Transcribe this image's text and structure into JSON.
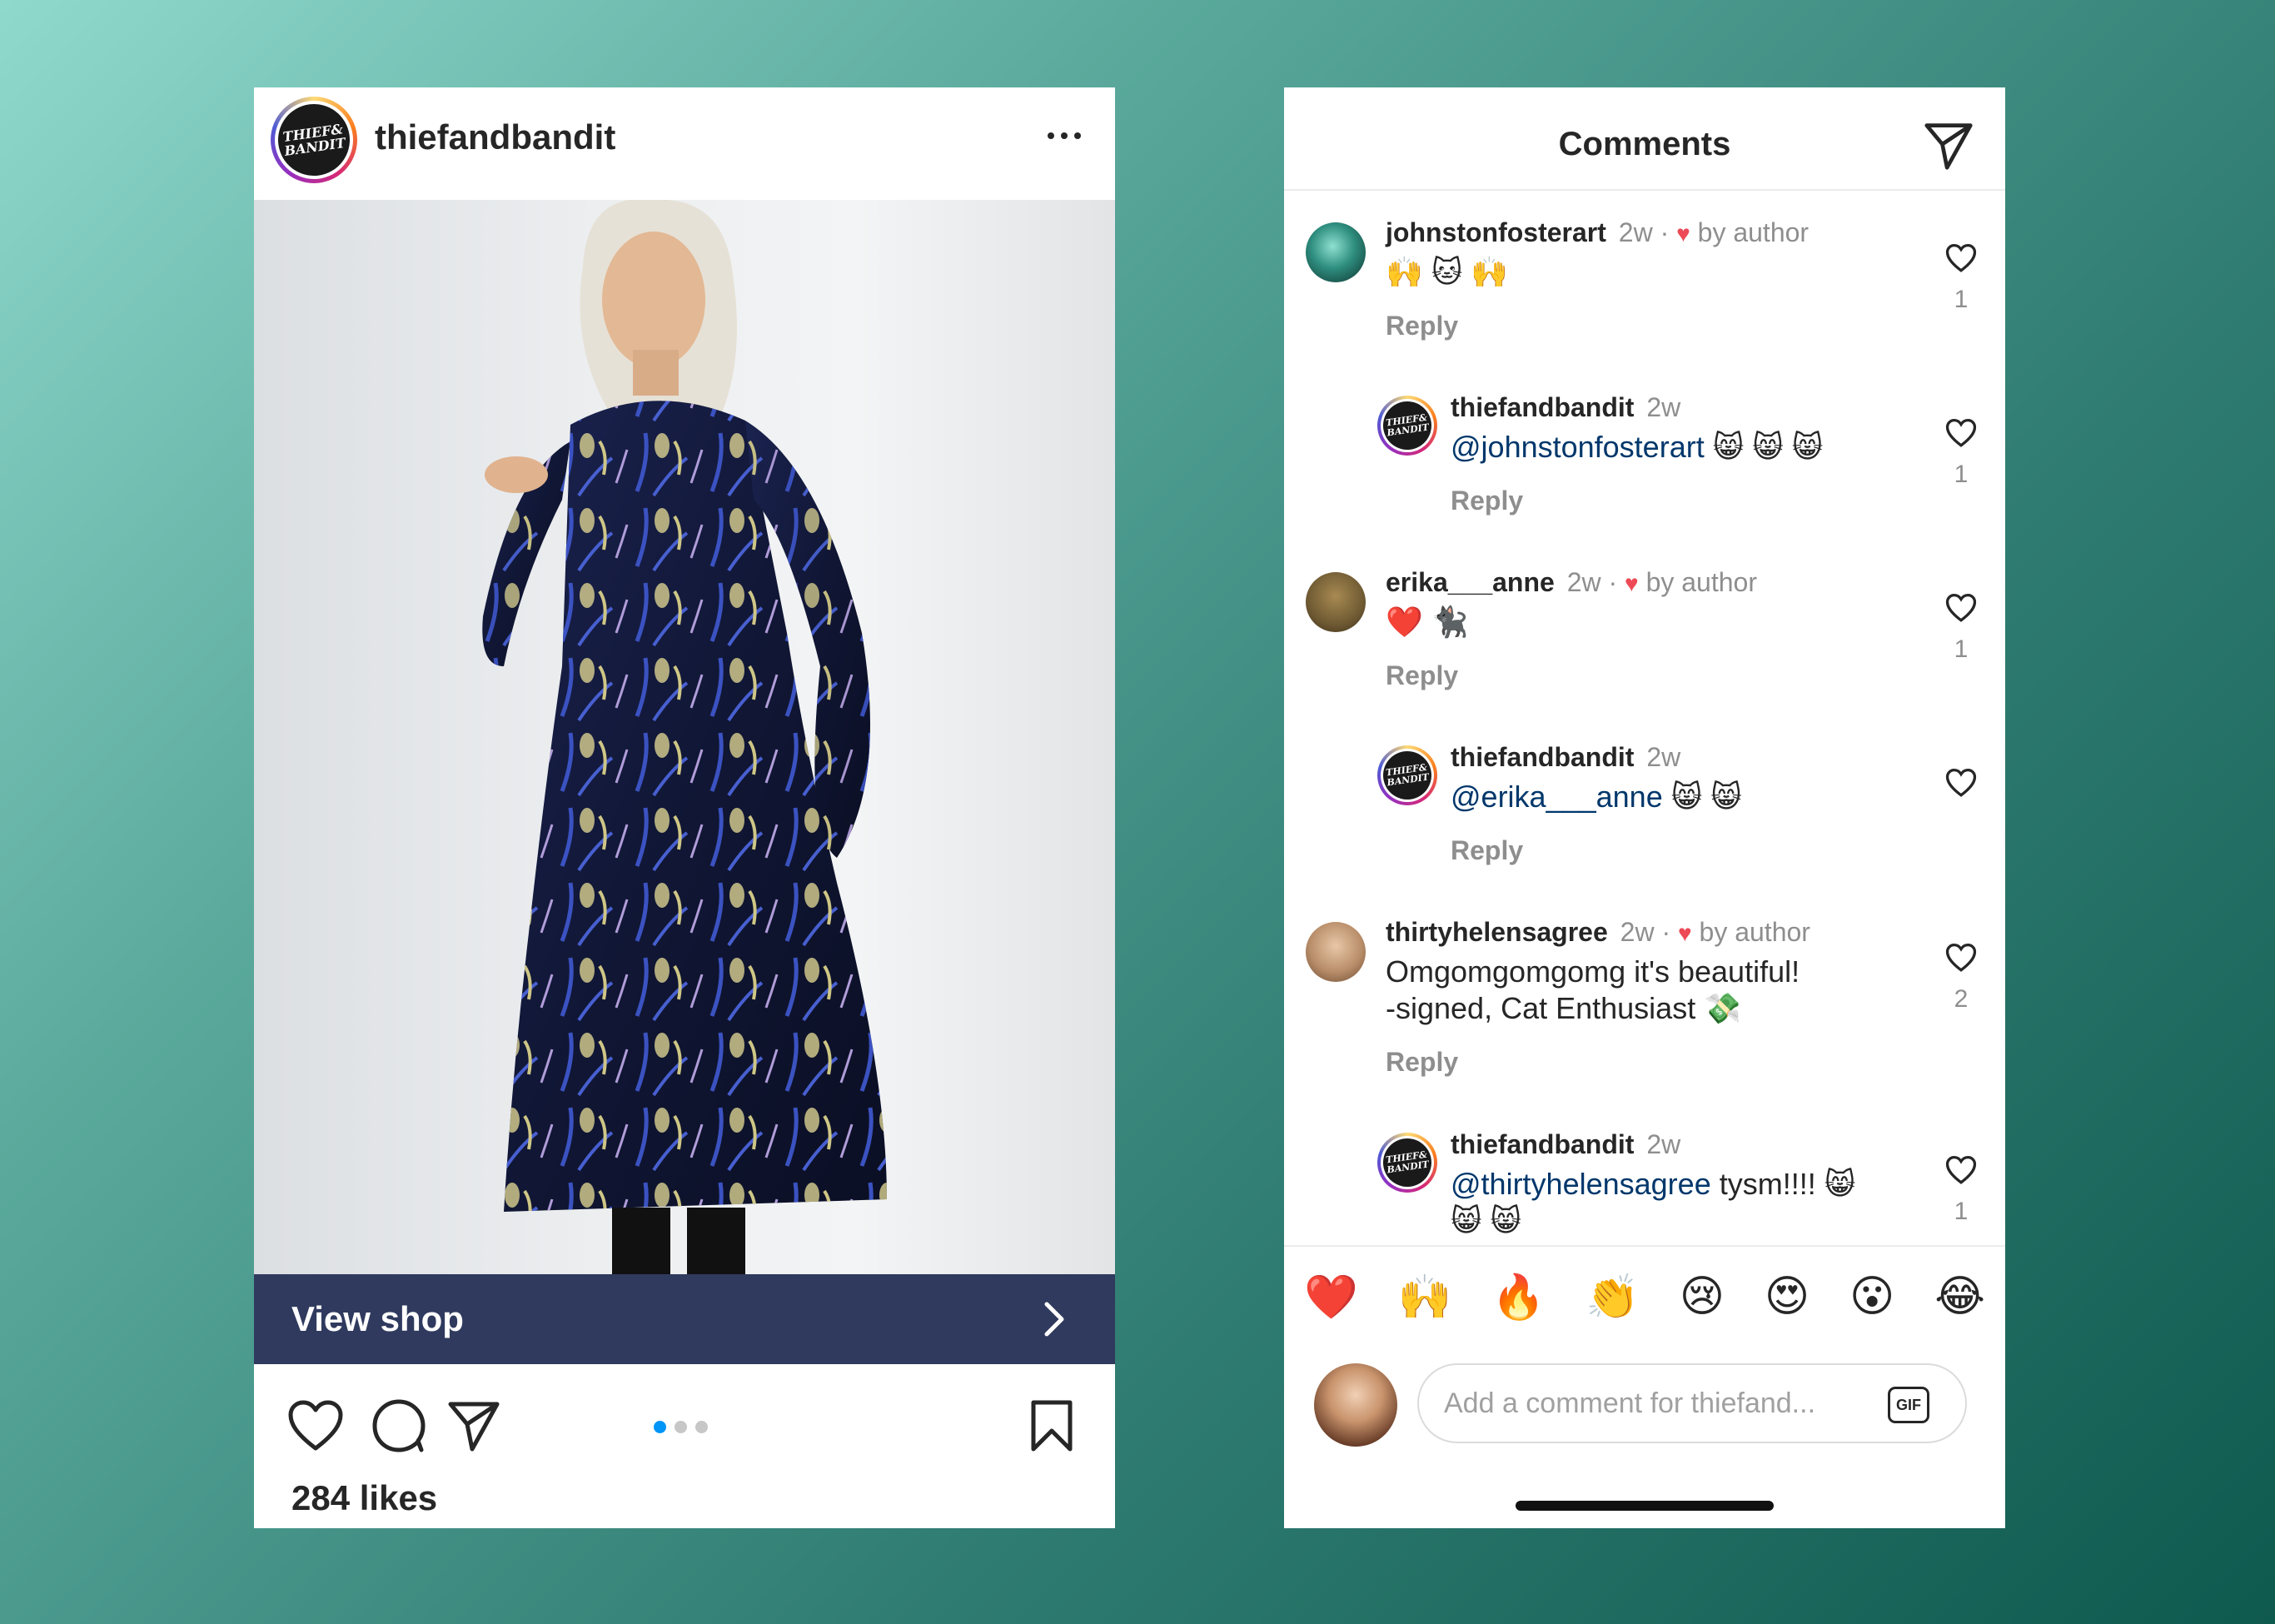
{
  "post": {
    "username": "thiefandbandit",
    "avatar_text": [
      "THIEF&",
      "BANDIT"
    ],
    "view_shop_label": "View shop",
    "likes_text": "284 likes",
    "carousel": {
      "count": 3,
      "active": 1
    }
  },
  "comments_panel": {
    "title": "Comments",
    "items": [
      {
        "user": "johnstonfosterart",
        "time": "2w",
        "liked_by_author": true,
        "by_author_label": "by author",
        "text": "🙌 🐱 🙌",
        "reply_label": "Reply",
        "likes": "1",
        "is_reply": false
      },
      {
        "user": "thiefandbandit",
        "time": "2w",
        "mention": "@johnstonfosterart",
        "text": " 😸 😸 😸",
        "reply_label": "Reply",
        "likes": "1",
        "is_reply": true
      },
      {
        "user": "erika___anne",
        "time": "2w",
        "liked_by_author": true,
        "by_author_label": "by author",
        "text": "❤️ 🐈‍⬛",
        "reply_label": "Reply",
        "likes": "1",
        "is_reply": false
      },
      {
        "user": "thiefandbandit",
        "time": "2w",
        "mention": "@erika___anne",
        "text": " 😸 😸",
        "reply_label": "Reply",
        "likes": "",
        "is_reply": true
      },
      {
        "user": "thirtyhelensagree",
        "time": "2w",
        "liked_by_author": true,
        "by_author_label": "by author",
        "text_line1": "Omgomgomgomg it's beautiful!",
        "text_line2": "-signed, Cat Enthusiast 💸",
        "reply_label": "Reply",
        "likes": "2",
        "is_reply": false
      },
      {
        "user": "thiefandbandit",
        "time": "2w",
        "mention": "@thirtyhelensagree",
        "text": " tysm!!!! 😸",
        "text_line2": "😸 😸",
        "likes": "1",
        "is_reply": true
      }
    ],
    "reactions": [
      "❤️",
      "🙌",
      "🔥",
      "👏",
      "😢",
      "😍",
      "😮",
      "😂"
    ],
    "composer": {
      "placeholder": "Add a comment for thiefand...",
      "gif_label": "GIF"
    }
  },
  "colors": {
    "accent_link": "#00376b",
    "shop_bar": "#2f3a5e",
    "like_red": "#ed4956",
    "carousel_active": "#0095f6"
  }
}
